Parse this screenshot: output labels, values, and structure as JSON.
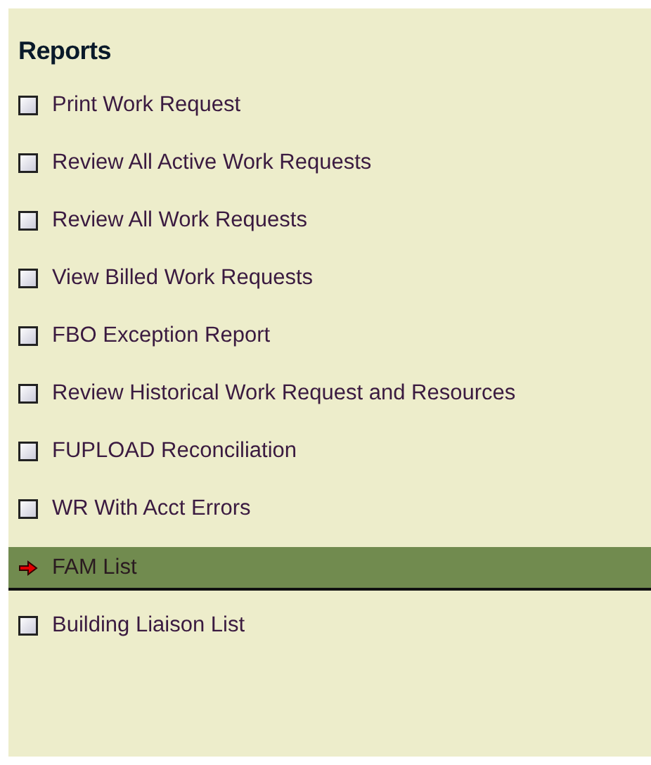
{
  "title": "Reports",
  "items": [
    {
      "label": "Print Work Request",
      "selected": false
    },
    {
      "label": "Review All Active Work Requests",
      "selected": false
    },
    {
      "label": "Review All Work Requests",
      "selected": false
    },
    {
      "label": "View Billed Work Requests",
      "selected": false
    },
    {
      "label": "FBO Exception Report",
      "selected": false
    },
    {
      "label": "Review Historical Work Request and Resources",
      "selected": false
    },
    {
      "label": "FUPLOAD Reconciliation",
      "selected": false
    },
    {
      "label": "WR With Acct Errors",
      "selected": false
    },
    {
      "label": "FAM List",
      "selected": true
    },
    {
      "label": "Building Liaison List",
      "selected": false
    }
  ]
}
